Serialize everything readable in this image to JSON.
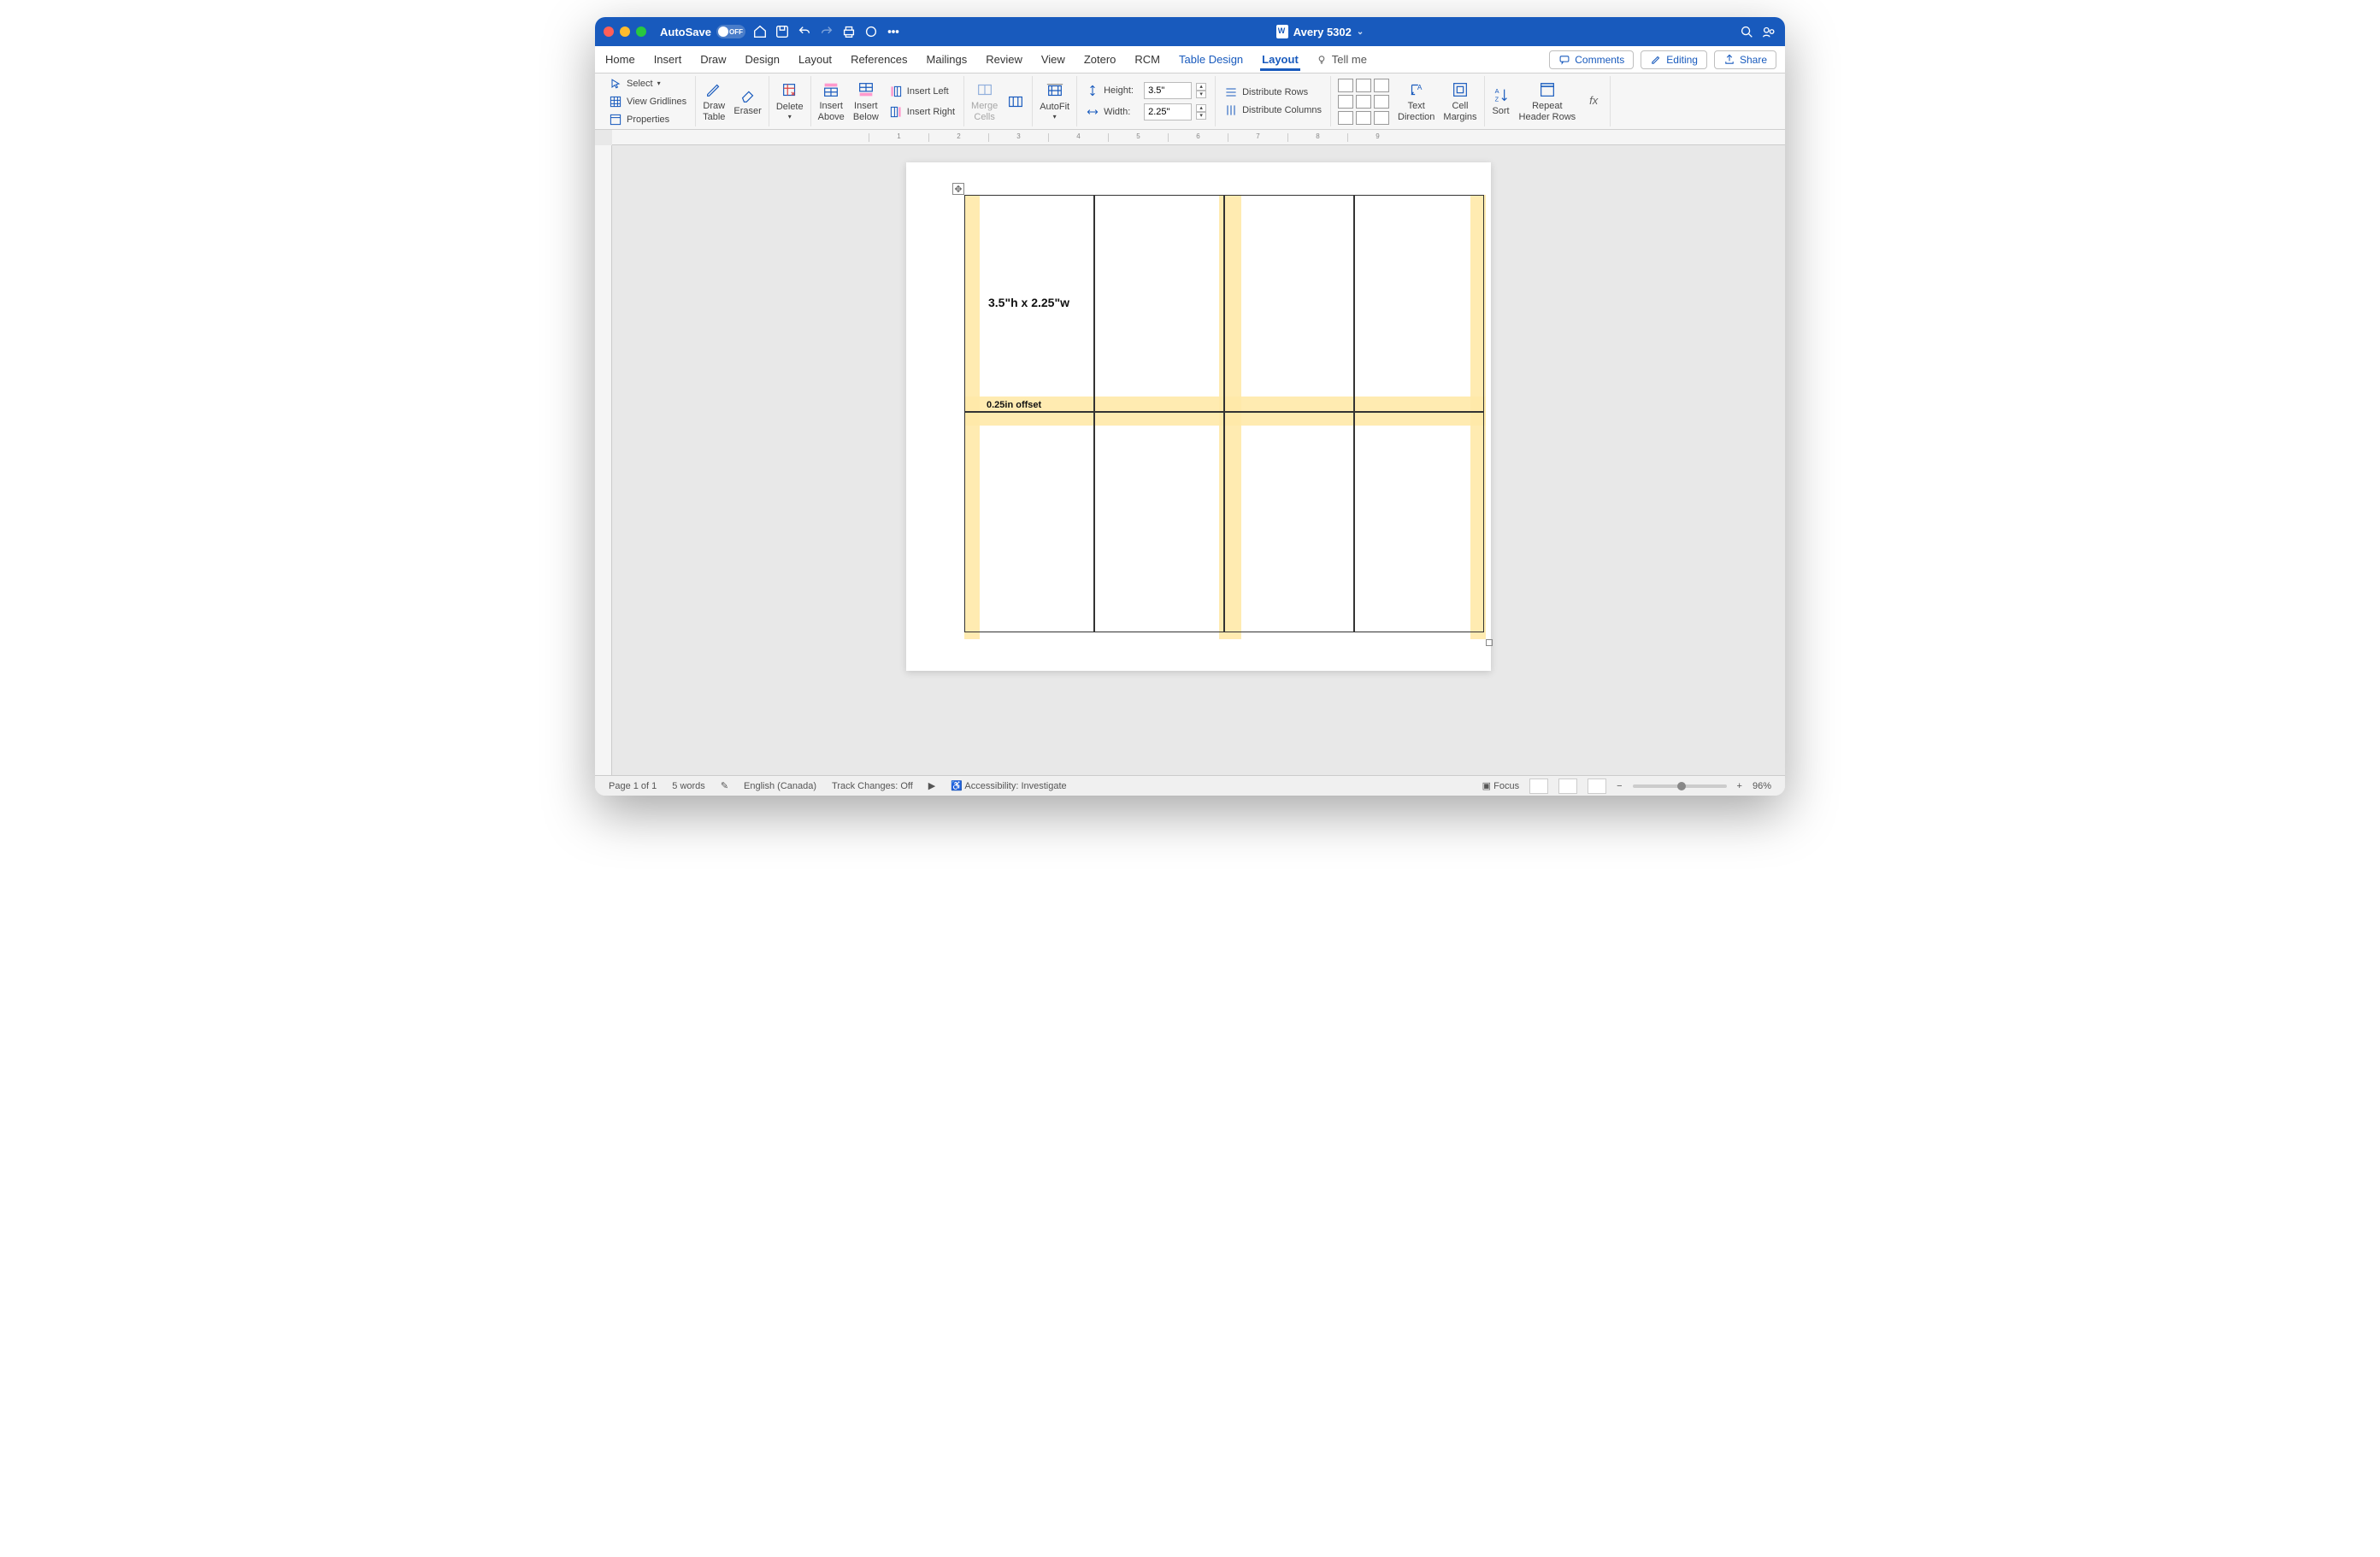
{
  "titlebar": {
    "autosave_label": "AutoSave",
    "autosave_state": "OFF",
    "doc_title": "Avery 5302"
  },
  "tabs": {
    "home": "Home",
    "insert": "Insert",
    "draw": "Draw",
    "design": "Design",
    "layout1": "Layout",
    "references": "References",
    "mailings": "Mailings",
    "review": "Review",
    "view": "View",
    "zotero": "Zotero",
    "rcm": "RCM",
    "table_design": "Table Design",
    "layout2": "Layout",
    "tellme": "Tell me",
    "comments": "Comments",
    "editing": "Editing",
    "share": "Share"
  },
  "ribbon": {
    "select": "Select",
    "view_gridlines": "View Gridlines",
    "properties": "Properties",
    "draw_table": "Draw\nTable",
    "eraser": "Eraser",
    "delete": "Delete",
    "insert_above": "Insert\nAbove",
    "insert_below": "Insert\nBelow",
    "insert_left": "Insert Left",
    "insert_right": "Insert Right",
    "merge_cells": "Merge\nCells",
    "split_cells": "",
    "autofit": "AutoFit",
    "height_label": "Height:",
    "height_value": "3.5\"",
    "width_label": "Width:",
    "width_value": "2.25\"",
    "dist_rows": "Distribute Rows",
    "dist_cols": "Distribute Columns",
    "text_direction": "Text\nDirection",
    "cell_margins": "Cell\nMargins",
    "sort": "Sort",
    "repeat_header": "Repeat\nHeader Rows",
    "fx": "fx"
  },
  "ruler": {
    "t1": "1",
    "t2": "2",
    "t3": "3",
    "t4": "4",
    "t5": "5",
    "t6": "6",
    "t7": "7",
    "t8": "8",
    "t9": "9"
  },
  "document": {
    "cell_label": "3.5\"h x 2.25\"w",
    "offset_label": "0.25in offset"
  },
  "status": {
    "page": "Page 1 of 1",
    "words": "5 words",
    "lang": "English (Canada)",
    "track": "Track Changes: Off",
    "a11y": "Accessibility: Investigate",
    "focus": "Focus",
    "zoom": "96%"
  }
}
